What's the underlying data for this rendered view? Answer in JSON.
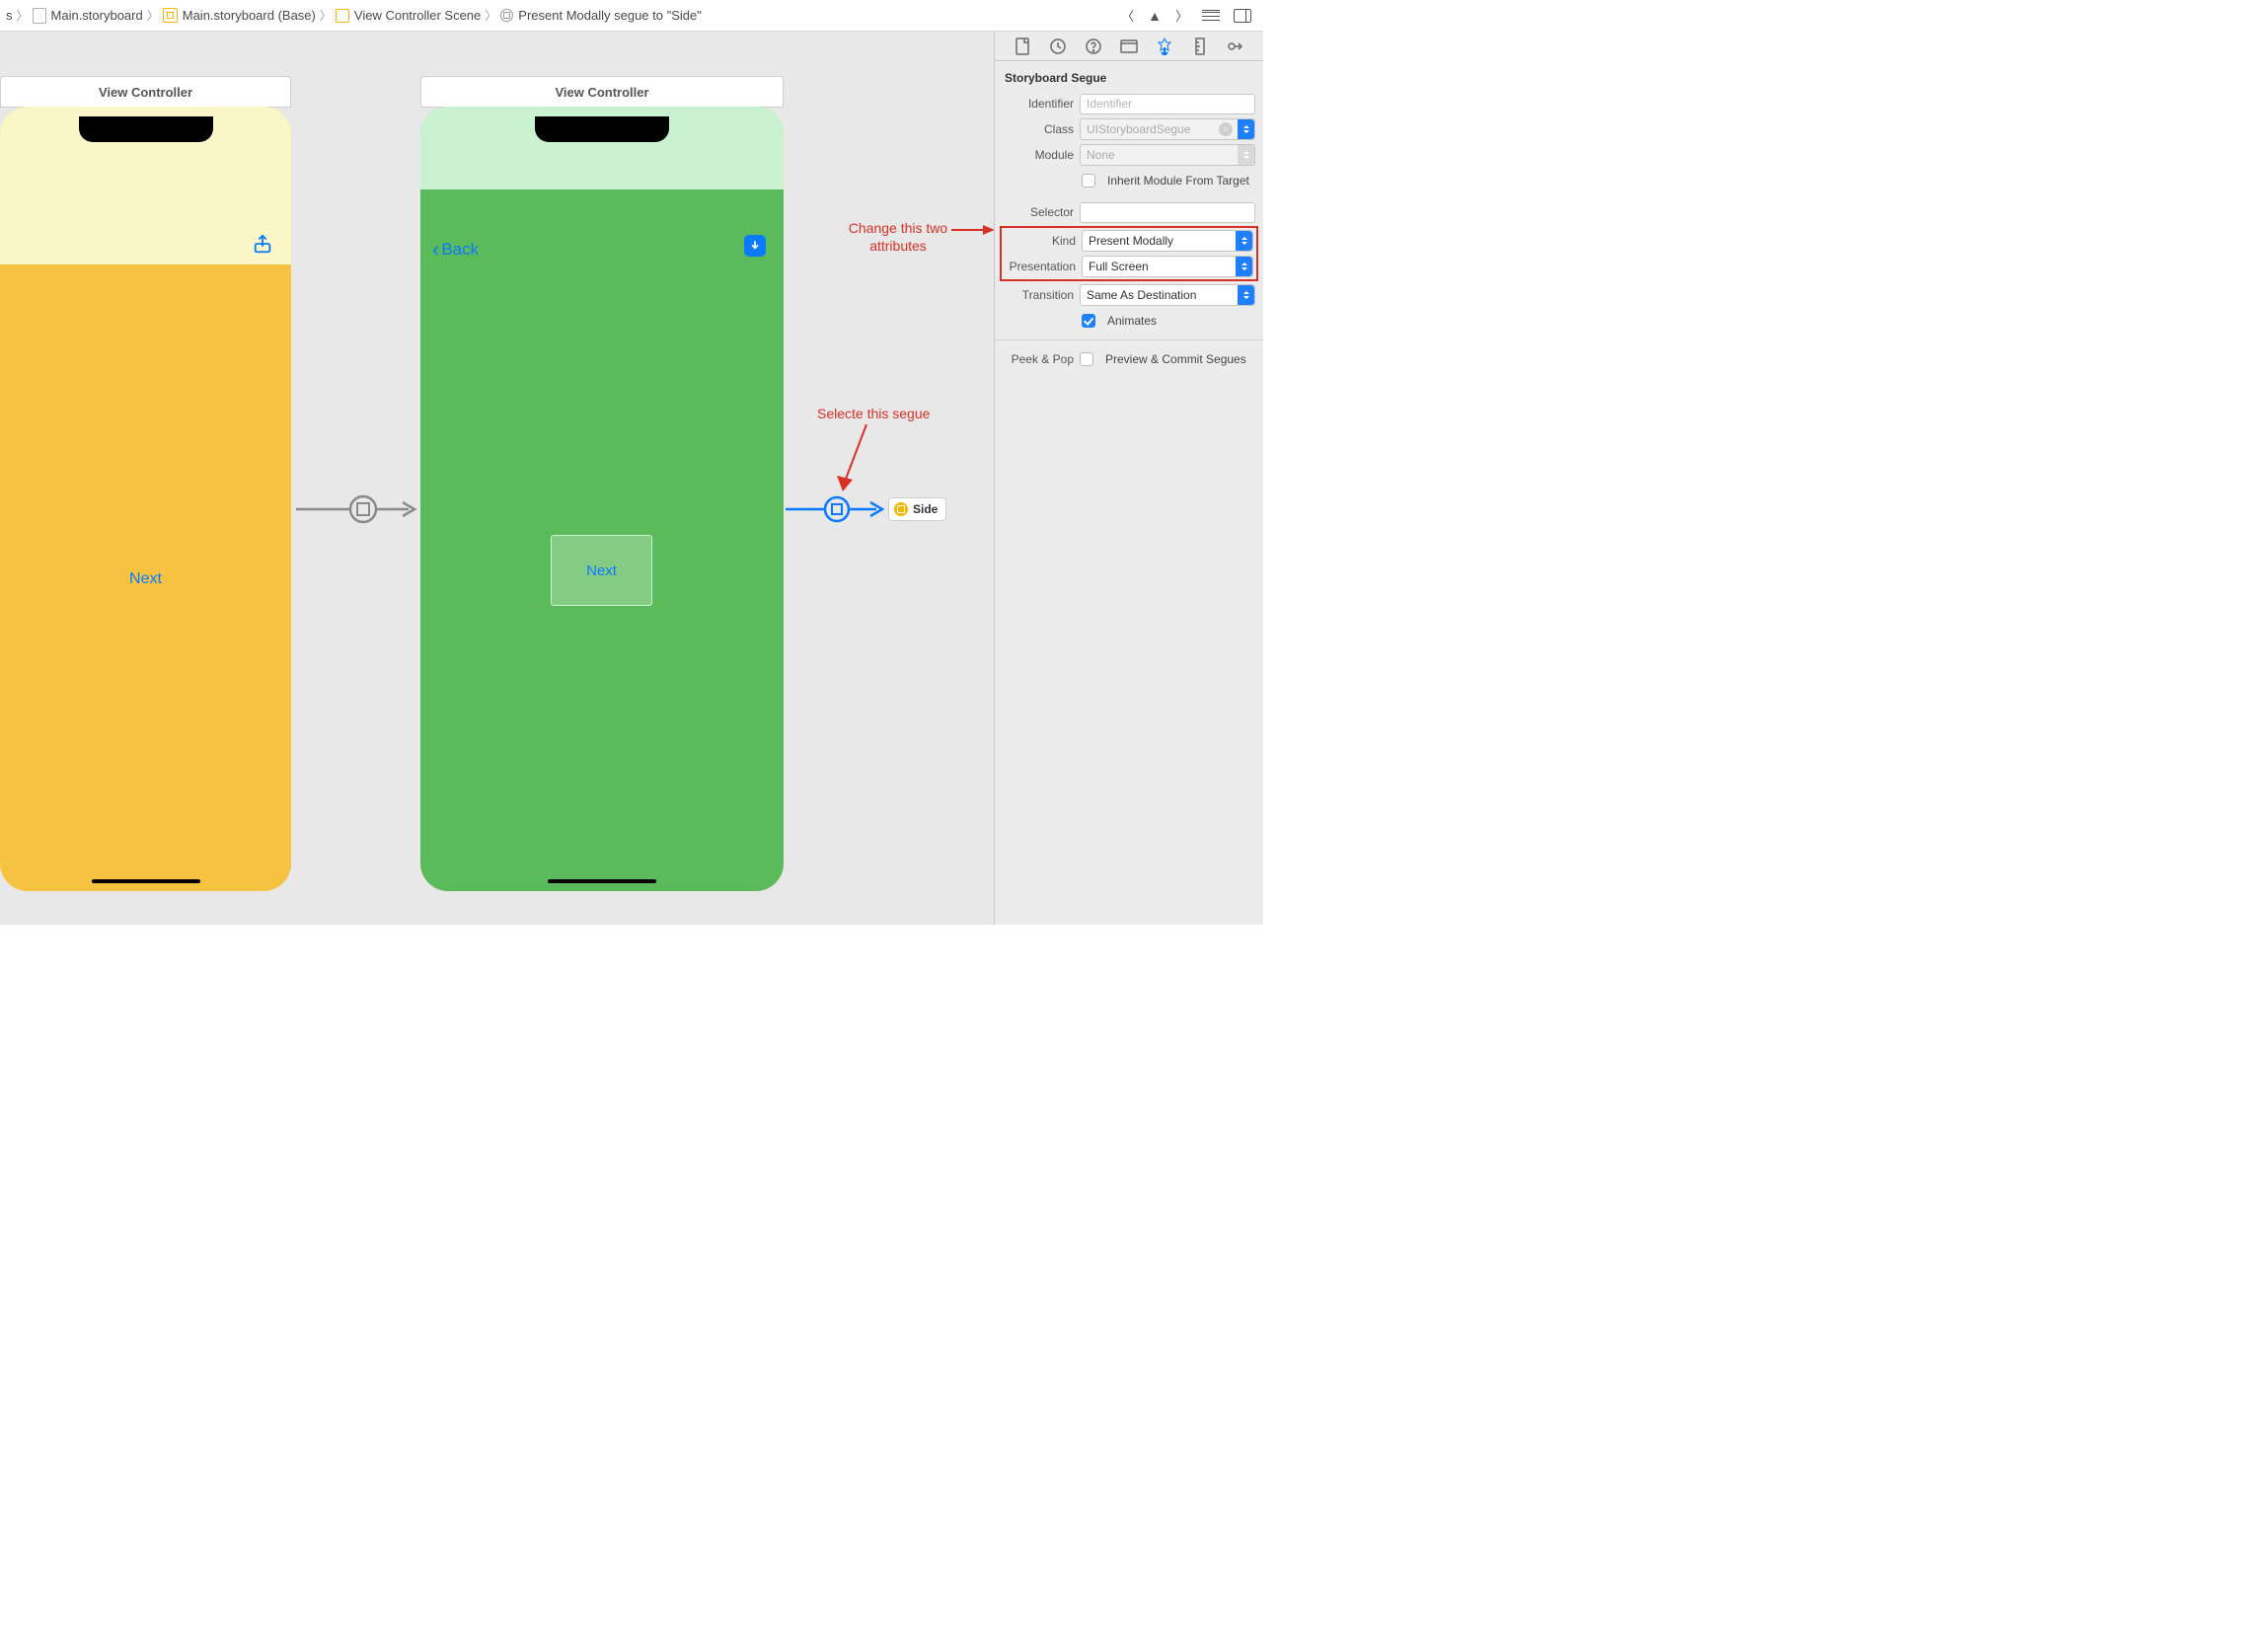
{
  "breadcrumb": {
    "item0_suffix": "s",
    "item1": "Main.storyboard",
    "item2": "Main.storyboard (Base)",
    "item3": "View Controller Scene",
    "item4": "Present Modally segue to \"Side\""
  },
  "canvas": {
    "vc1_title": "View Controller",
    "vc2_title": "View Controller",
    "vc1_button": "Next",
    "vc2_back": "Back",
    "vc2_button": "Next",
    "side_chip": "Side"
  },
  "annotations": {
    "attrs_line1": "Change this two",
    "attrs_line2": "attributes",
    "segue": "Selecte this segue"
  },
  "inspector": {
    "section_title": "Storyboard Segue",
    "labels": {
      "identifier": "Identifier",
      "class": "Class",
      "module": "Module",
      "inherit": "Inherit Module From Target",
      "selector": "Selector",
      "kind": "Kind",
      "presentation": "Presentation",
      "transition": "Transition",
      "animates": "Animates",
      "peekpop": "Peek & Pop",
      "preview": "Preview & Commit Segues"
    },
    "values": {
      "identifier_placeholder": "Identifier",
      "class_placeholder": "UIStoryboardSegue",
      "module_placeholder": "None",
      "kind": "Present Modally",
      "presentation": "Full Screen",
      "transition": "Same As Destination",
      "animates_checked": true,
      "inherit_checked": false,
      "preview_checked": false
    }
  }
}
